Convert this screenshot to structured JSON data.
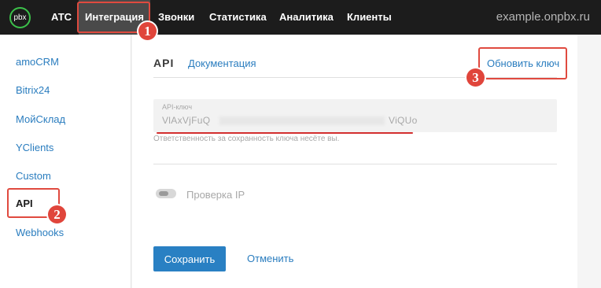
{
  "header": {
    "logo_text": "pbx",
    "nav": [
      "АТС",
      "Интеграция",
      "Звонки",
      "Статистика",
      "Аналитика",
      "Клиенты"
    ],
    "active_nav": "Интеграция",
    "domain": "example.onpbx.ru"
  },
  "sidebar": {
    "items": [
      "amoCRM",
      "Bitrix24",
      "МойСклад",
      "YClients",
      "Custom",
      "API",
      "Webhooks"
    ],
    "active": "API"
  },
  "main": {
    "tab_title": "API",
    "docs_link": "Документация",
    "renew_key": "Обновить ключ",
    "key_label": "API-ключ",
    "key_value_start": "VlAxVjFuQ",
    "key_value_end": "ViQUo",
    "key_hint": "Ответственность за сохранность ключа несёте вы.",
    "ip_check_label": "Проверка IP",
    "ip_check_enabled": false,
    "save_button": "Сохранить",
    "cancel_link": "Отменить"
  },
  "annotations": [
    "1",
    "2",
    "3"
  ],
  "colors": {
    "accent": "#2a7dbf",
    "annotation": "#e0453b",
    "topbar": "#1c1c1c",
    "logo_ring": "#3cc14a"
  }
}
